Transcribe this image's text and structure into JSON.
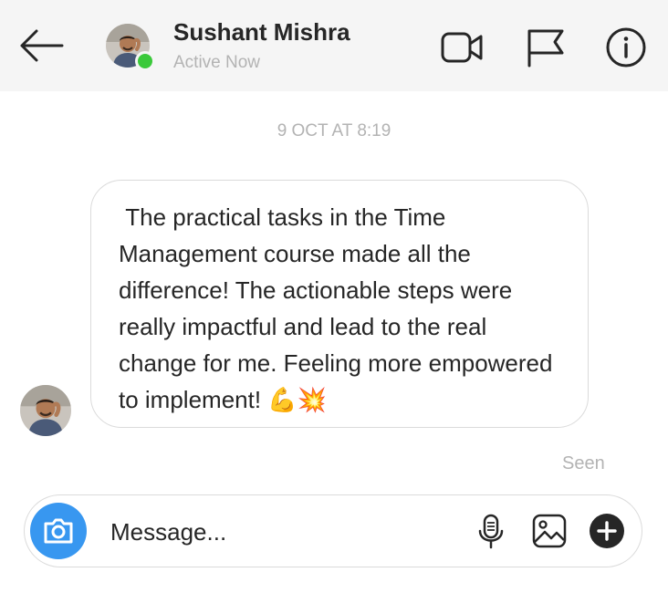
{
  "header": {
    "back_icon": "arrow-left-icon",
    "user_name": "Sushant Mishra",
    "status": "Active Now",
    "online_color": "#3ac93a",
    "actions": [
      "video-call-icon",
      "flag-icon",
      "info-icon"
    ]
  },
  "conversation": {
    "timestamp": "9 OCT AT 8:19",
    "message": " The practical tasks in the Time Management course made all the difference! The actionable steps were really impactful and lead to the real change for me. Feeling more empowered to implement! 💪💥",
    "seen_label": "Seen"
  },
  "composer": {
    "placeholder": "Message...",
    "camera_icon": "camera-icon",
    "accent_color": "#3897f0",
    "icons": [
      "microphone-icon",
      "gallery-icon",
      "add-icon"
    ]
  }
}
